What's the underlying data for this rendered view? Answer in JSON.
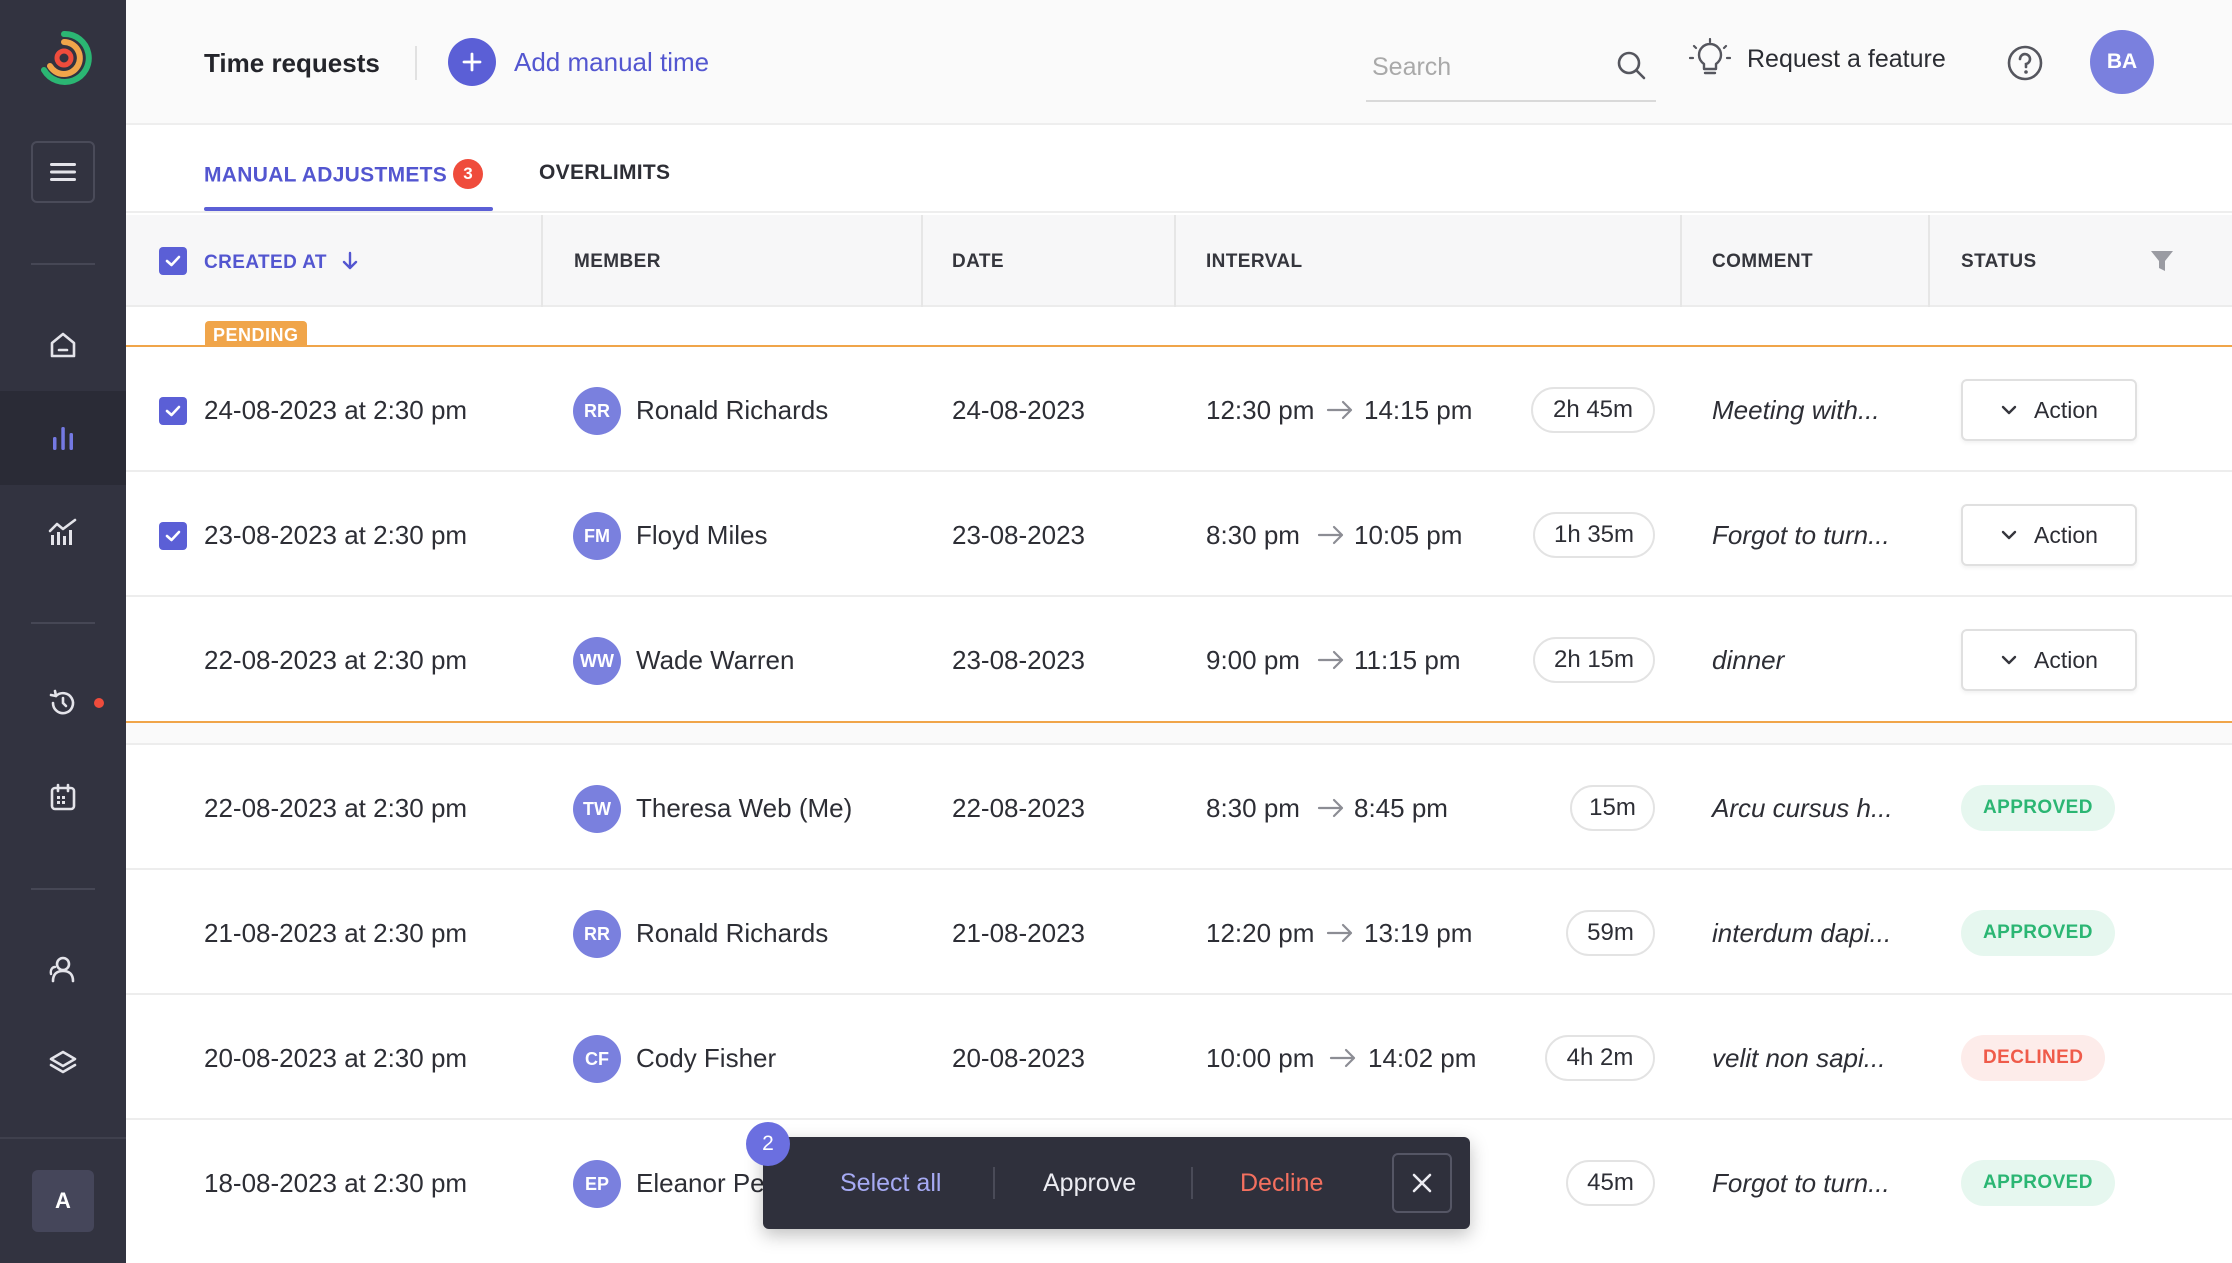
{
  "header": {
    "title": "Time requests",
    "add_label": "Add manual time",
    "search_placeholder": "Search",
    "feature_label": "Request a feature",
    "avatar_initials": "BA"
  },
  "sidebar": {
    "avatar_initial": "A",
    "items": [
      {
        "icon": "home-icon"
      },
      {
        "icon": "bar-chart-icon",
        "active": true
      },
      {
        "icon": "analytics-icon"
      },
      {
        "icon": "history-icon",
        "notification": true
      },
      {
        "icon": "calendar-icon"
      },
      {
        "icon": "users-icon"
      },
      {
        "icon": "layers-icon"
      }
    ]
  },
  "tabs": [
    {
      "label": "MANUAL ADJUSTMETS",
      "badge": "3",
      "active": true
    },
    {
      "label": "OVERLIMITS",
      "active": false
    }
  ],
  "table": {
    "columns": [
      "CREATED AT",
      "MEMBER",
      "DATE",
      "INTERVAL",
      "COMMENT",
      "STATUS"
    ],
    "pending_label": "PENDING",
    "action_label": "Action",
    "pending_rows": [
      {
        "created": "24-08-2023 at 2:30 pm",
        "initials": "RR",
        "member": "Ronald Richards",
        "date": "24-08-2023",
        "start": "12:30 pm",
        "end": "14:15 pm",
        "duration": "2h 45m",
        "comment": "Meeting with...",
        "checked": true
      },
      {
        "created": "23-08-2023 at 2:30 pm",
        "initials": "FM",
        "member": "Floyd Miles",
        "date": "23-08-2023",
        "start": "8:30 pm",
        "end": "10:05 pm",
        "duration": "1h 35m",
        "comment": "Forgot to turn...",
        "checked": true
      },
      {
        "created": "22-08-2023 at 2:30 pm",
        "initials": "WW",
        "member": "Wade Warren",
        "date": "23-08-2023",
        "start": "9:00 pm",
        "end": "11:15 pm",
        "duration": "2h 15m",
        "comment": "dinner",
        "checked": false
      }
    ],
    "rows": [
      {
        "created": "22-08-2023 at 2:30 pm",
        "initials": "TW",
        "member": "Theresa Web (Me)",
        "date": "22-08-2023",
        "start": "8:30 pm",
        "end": "8:45 pm",
        "duration": "15m",
        "comment": "Arcu cursus h...",
        "status": "APPROVED"
      },
      {
        "created": "21-08-2023 at 2:30 pm",
        "initials": "RR",
        "member": "Ronald Richards",
        "date": "21-08-2023",
        "start": "12:20 pm",
        "end": "13:19 pm",
        "duration": "59m",
        "comment": "interdum dapi...",
        "status": "APPROVED"
      },
      {
        "created": "20-08-2023 at 2:30 pm",
        "initials": "CF",
        "member": "Cody Fisher",
        "date": "20-08-2023",
        "start": "10:00 pm",
        "end": "14:02 pm",
        "duration": "4h 2m",
        "comment": "velit non sapi...",
        "status": "DECLINED"
      },
      {
        "created": "18-08-2023 at 2:30 pm",
        "initials": "EP",
        "member": "Eleanor Pe",
        "date": "",
        "start": "",
        "end": "",
        "duration": "45m",
        "comment": "Forgot to turn...",
        "status": "APPROVED"
      }
    ]
  },
  "bulk_bar": {
    "count": "2",
    "select_all": "Select all",
    "approve": "Approve",
    "decline": "Decline"
  },
  "colors": {
    "accent": "#5b5fd6",
    "sidebar": "#323340",
    "pending": "#f0a54a",
    "approved": "#2bb673",
    "declined": "#ef5b4a",
    "badge": "#ef4c3c"
  }
}
